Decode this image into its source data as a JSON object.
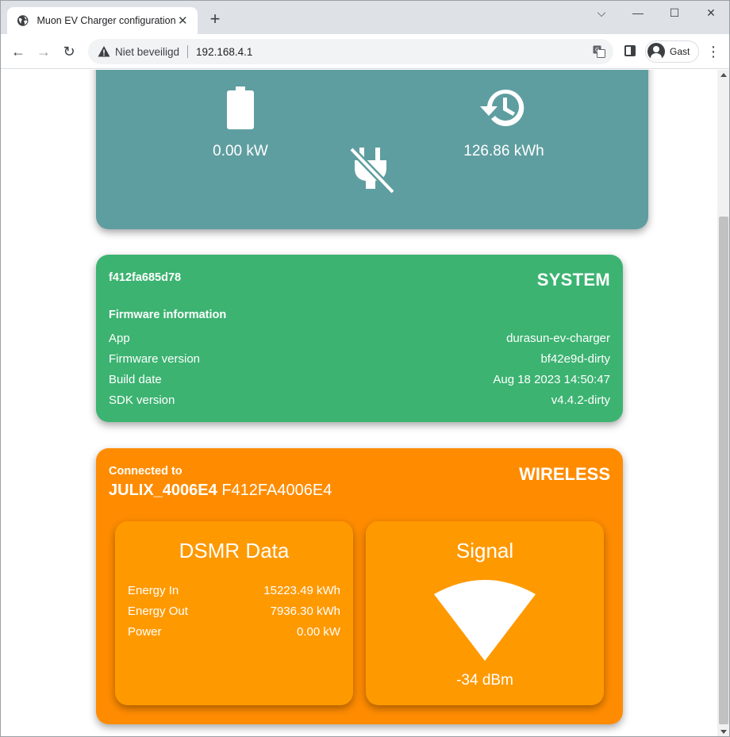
{
  "browser": {
    "tab_title": "Muon EV Charger configuration",
    "security_label": "Niet beveiligd",
    "url": "192.168.4.1",
    "profile_name": "Gast"
  },
  "power_card": {
    "power_value": "0.00 kW",
    "session_value": "126.86 kWh",
    "color": "#5f9ea0"
  },
  "system_card": {
    "device_id": "f412fa685d78",
    "title": "SYSTEM",
    "firmware_title": "Firmware information",
    "rows": [
      {
        "label": "App",
        "value": "durasun-ev-charger"
      },
      {
        "label": "Firmware version",
        "value": "bf42e9d-dirty"
      },
      {
        "label": "Build date",
        "value": "Aug 18 2023 14:50:47"
      },
      {
        "label": "SDK version",
        "value": "v4.4.2-dirty"
      }
    ],
    "color": "#3cb371"
  },
  "wireless_card": {
    "connected_label": "Connected to",
    "ssid": "JULIX_4006E4",
    "bssid": "F412FA4006E4",
    "title": "WIRELESS",
    "color": "#ff8c00",
    "dsmr": {
      "title": "DSMR Data",
      "rows": [
        {
          "label": "Energy In",
          "value": "15223.49 kWh"
        },
        {
          "label": "Energy Out",
          "value": "7936.30 kWh"
        },
        {
          "label": "Power",
          "value": "0.00 kW"
        }
      ]
    },
    "signal": {
      "title": "Signal",
      "value": "-34 dBm"
    }
  },
  "icons": [
    "globe-icon",
    "close-icon",
    "plus-icon",
    "minimize-icon",
    "maximize-icon",
    "window-close-icon",
    "back-icon",
    "forward-icon",
    "reload-icon",
    "warning-icon",
    "translate-icon",
    "side-panel-icon",
    "avatar-icon",
    "menu-icon",
    "battery-icon",
    "history-icon",
    "plug-off-icon",
    "wifi-signal-icon"
  ]
}
